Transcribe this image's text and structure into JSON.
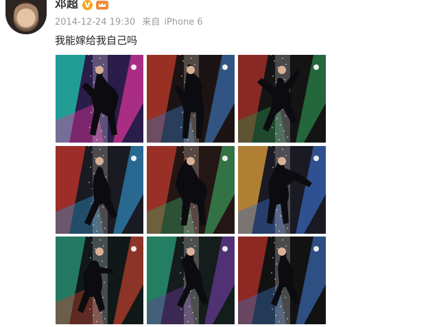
{
  "post": {
    "username": "邓超",
    "verified_badge": "V",
    "timestamp": "2014-12-24 19:30",
    "source_prefix": "来自",
    "source_device": "iPhone 6",
    "text": "我能嫁给我自己吗"
  },
  "icons": {
    "avatar": "avatar-photo",
    "verified": "verified-v-badge",
    "member": "crown-icon"
  },
  "colors": {
    "verified": "#f5a623",
    "member_crown": "#f08a3c",
    "meta_text": "#9a9a9a",
    "body_text": "#222222"
  },
  "photos": [
    {
      "name": "photo-1",
      "bg": "#2a1d4a",
      "accent1": "#1fc8b0",
      "accent2": "#e0359a",
      "accent3": "#f7f0ff",
      "pose": "a"
    },
    {
      "name": "photo-2",
      "bg": "#1c1414",
      "accent1": "#c23a2a",
      "accent2": "#3c6fb0",
      "accent3": "#f2e6d8",
      "pose": "b"
    },
    {
      "name": "photo-3",
      "bg": "#141414",
      "accent1": "#b0302a",
      "accent2": "#2a8a4a",
      "accent3": "#e8e8f0",
      "pose": "c"
    },
    {
      "name": "photo-4",
      "bg": "#1a1a22",
      "accent1": "#c8342c",
      "accent2": "#2f8ac0",
      "accent3": "#e8dcd0",
      "pose": "d"
    },
    {
      "name": "photo-5",
      "bg": "#241614",
      "accent1": "#c03a2e",
      "accent2": "#3a9a5a",
      "accent3": "#f0e0d0",
      "pose": "e"
    },
    {
      "name": "photo-6",
      "bg": "#1a1a24",
      "accent1": "#e2a23a",
      "accent2": "#3a6ac0",
      "accent3": "#f0e8e0",
      "pose": "f"
    },
    {
      "name": "photo-7",
      "bg": "#101818",
      "accent1": "#2a9a7a",
      "accent2": "#c0402e",
      "accent3": "#e8ecf0",
      "pose": "g"
    },
    {
      "name": "photo-8",
      "bg": "#141c1c",
      "accent1": "#2aa07a",
      "accent2": "#6a3a9a",
      "accent3": "#eee8e0",
      "pose": "h"
    },
    {
      "name": "photo-9",
      "bg": "#121212",
      "accent1": "#b8302a",
      "accent2": "#3a6ab0",
      "accent3": "#f0f0f4",
      "pose": "i"
    }
  ]
}
